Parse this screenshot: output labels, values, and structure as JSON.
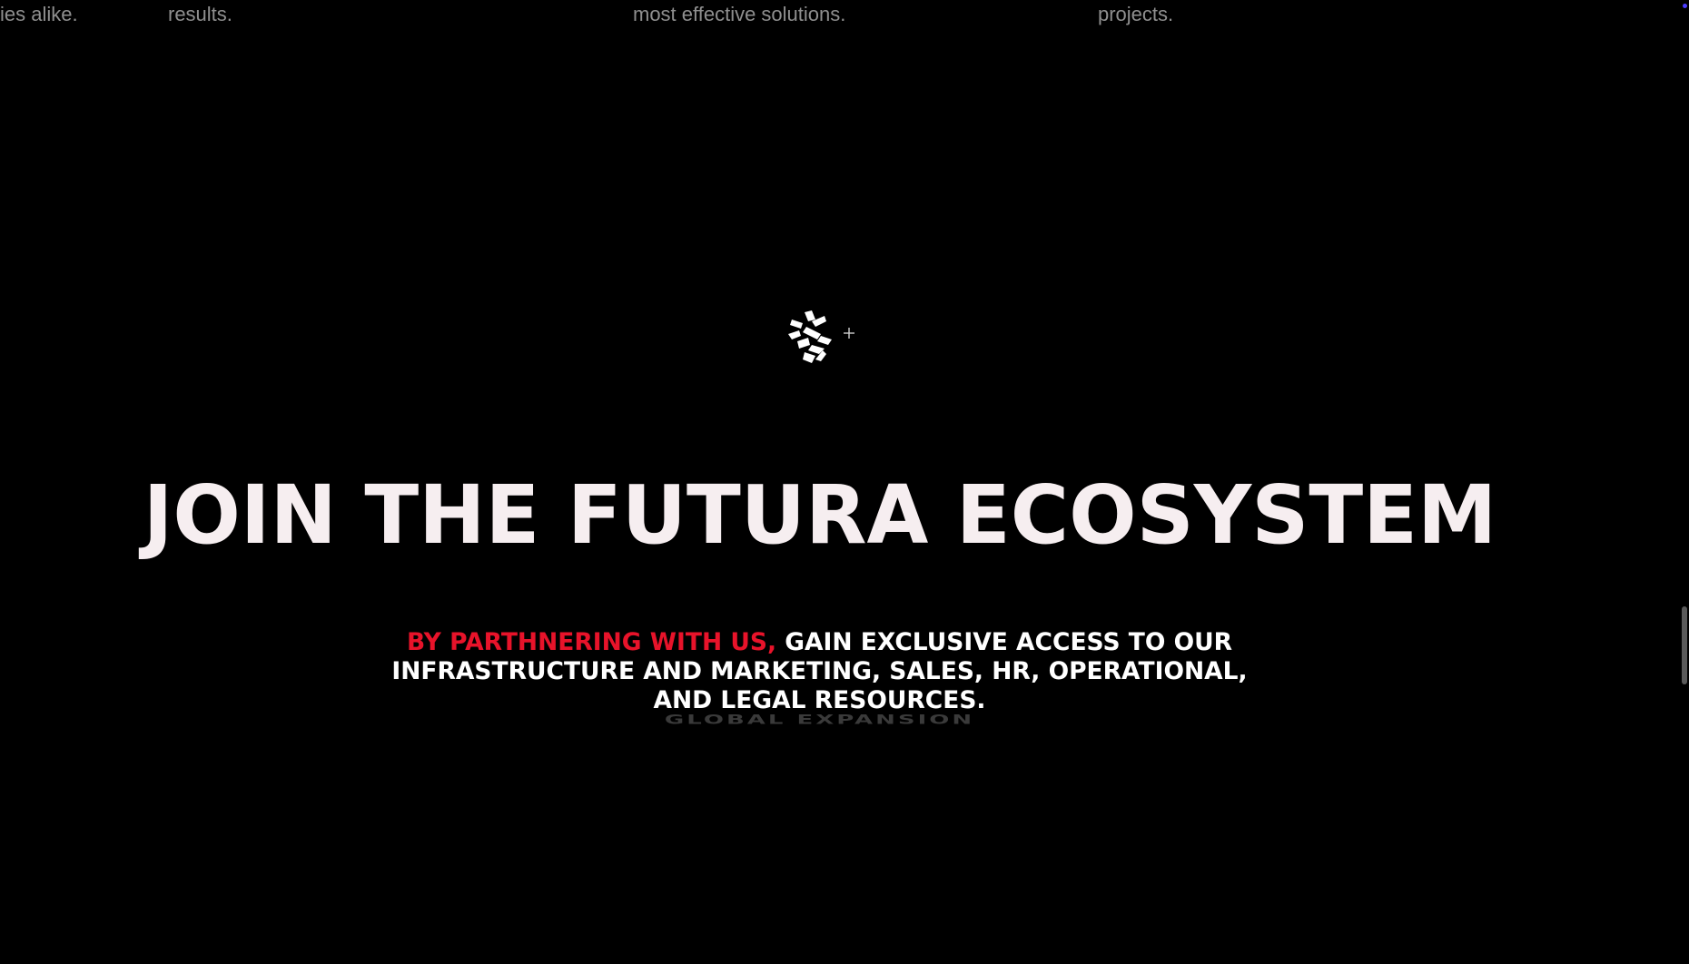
{
  "top_snippets": {
    "s1": "ies alike.",
    "s2": "results.",
    "s3": "most effective solutions.",
    "s4": "projects."
  },
  "logo": {
    "icon": "futura-logo-icon",
    "plus_icon": "plus-icon"
  },
  "hero": {
    "headline": "JOIN THE FUTURA ECOSYSTEM",
    "subtext_accent": "BY PARTHNERING WITH US,",
    "subtext_rest": " GAIN EXCLUSIVE ACCESS TO OUR INFRASTRUCTURE AND MARKETING, SALES, HR, OPERATIONAL, AND LEGAL RESOURCES.",
    "ghost_label": "GLOBAL EXPANSION"
  },
  "colors": {
    "background": "#000000",
    "headline": "#f6eef0",
    "accent": "#e8132a",
    "body_text": "#ffffff",
    "muted_text": "#8f8f8f",
    "corner_dot": "#4b3cff"
  }
}
